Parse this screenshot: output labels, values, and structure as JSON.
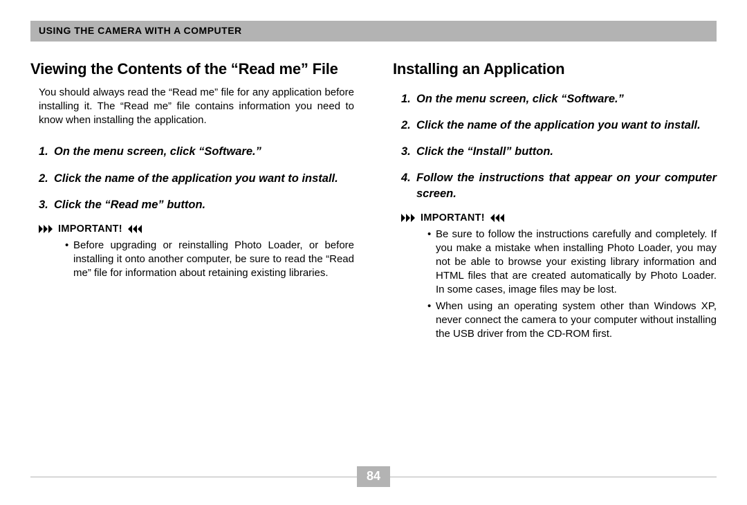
{
  "header": "USING THE CAMERA WITH A COMPUTER",
  "left": {
    "heading": "Viewing the Contents of the “Read me” File",
    "intro": "You should always read the “Read me” file for any application before installing it. The “Read me” file contains information you need to know when installing the application.",
    "steps": [
      "On the menu screen, click “Software.”",
      "Click the name of the application you want to install.",
      "Click the “Read me” button."
    ],
    "important_label": "IMPORTANT!",
    "important_bullets": [
      "Before upgrading or reinstalling Photo Loader, or before installing it onto another computer, be sure to read the “Read me” file for information about retaining existing libraries."
    ]
  },
  "right": {
    "heading": "Installing an Application",
    "steps": [
      "On the menu screen, click “Software.”",
      "Click the name of the application you want to install.",
      "Click the “Install” button.",
      "Follow the instructions that appear on your computer screen."
    ],
    "important_label": "IMPORTANT!",
    "important_bullets": [
      "Be sure to follow the instructions carefully and completely. If you make a mistake when installing Photo Loader, you may not be able to browse your existing library information and HTML files that are created automatically by Photo Loader. In some cases, image files may be lost.",
      "When using an operating system other than Windows XP, never connect the camera to your computer without installing the USB driver from the CD-ROM first."
    ]
  },
  "page_number": "84"
}
